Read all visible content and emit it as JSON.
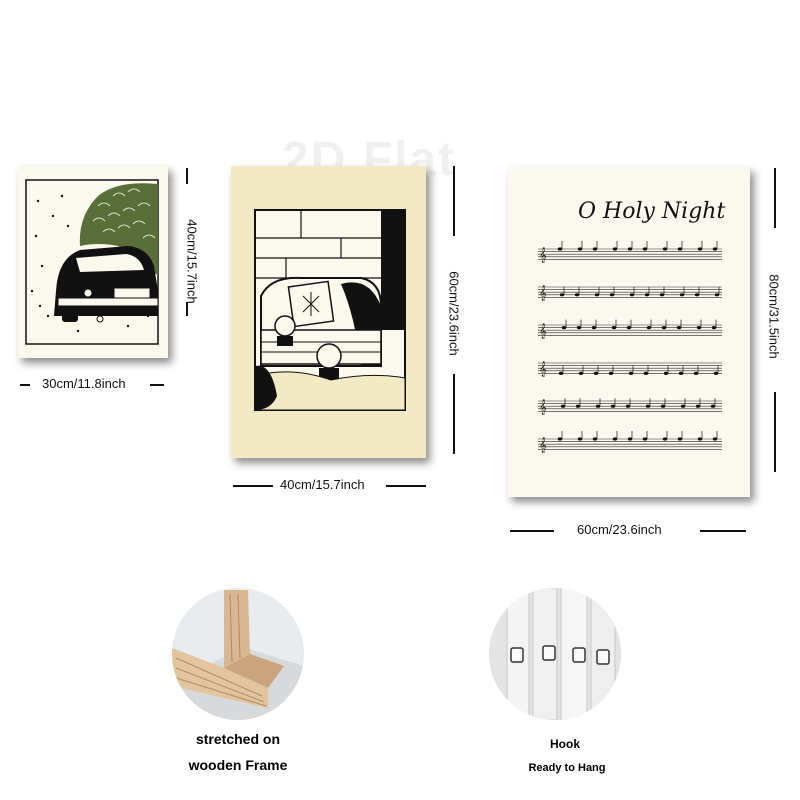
{
  "watermark": "2D Flat",
  "prints": {
    "small": {
      "width_label": "30cm/11.8inch",
      "height_label": "40cm/15.7inch"
    },
    "medium": {
      "width_label": "40cm/15.7inch",
      "height_label": "60cm/23.6inch"
    },
    "large": {
      "title": "O Holy Night",
      "width_label": "60cm/23.6inch",
      "height_label": "80cm/31.5inch",
      "staff_count": 6
    }
  },
  "details": {
    "frame": {
      "caption_line1": "stretched on",
      "caption_line2": "wooden Frame"
    },
    "hook": {
      "caption_line1": "Hook",
      "caption_line2": "Ready to Hang"
    }
  },
  "colors": {
    "tree_green": "#5a6e3a",
    "sofa_bg": "#f2e9c5",
    "ink": "#111111",
    "paper": "#fbf9ef",
    "wood": "#d8b892"
  }
}
